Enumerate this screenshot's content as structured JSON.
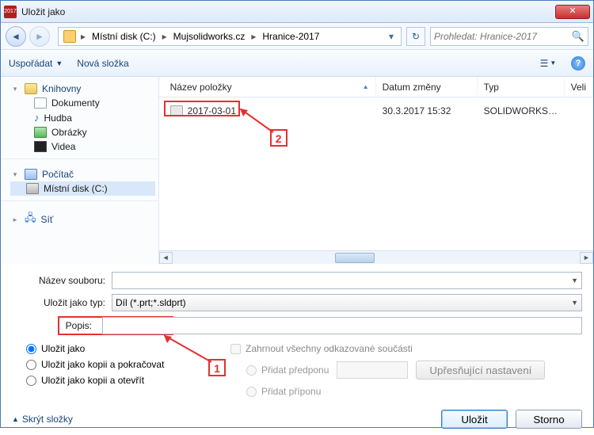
{
  "window": {
    "title": "Uložit jako",
    "app_badge": "2017"
  },
  "nav": {
    "breadcrumb": [
      "Místní disk (C:)",
      "Mujsolidworks.cz",
      "Hranice-2017"
    ],
    "search_placeholder": "Prohledat: Hranice-2017"
  },
  "toolbar": {
    "organize": "Uspořádat",
    "new_folder": "Nová složka"
  },
  "tree": {
    "libraries": "Knihovny",
    "documents": "Dokumenty",
    "music": "Hudba",
    "pictures": "Obrázky",
    "videos": "Videa",
    "computer": "Počítač",
    "local_disk": "Místní disk (C:)",
    "network": "Síť"
  },
  "columns": {
    "name": "Název položky",
    "date": "Datum změny",
    "type": "Typ",
    "size": "Veli"
  },
  "files": [
    {
      "name": "2017-03-01",
      "date": "30.3.2017 15:32",
      "type": "SOLIDWORKS Part..."
    }
  ],
  "form": {
    "filename_label": "Název souboru:",
    "filename_value": "",
    "filetype_label": "Uložit jako typ:",
    "filetype_value": "Díl (*.prt;*.sldprt)",
    "description_label": "Popis:"
  },
  "options": {
    "save_as": "Uložit jako",
    "save_copy_continue": "Uložit jako kopii a pokračovat",
    "save_copy_open": "Uložit jako kopii a otevřít",
    "include_refs": "Zahrnout všechny odkazované součásti",
    "add_prefix": "Přidat předponu",
    "add_suffix": "Přidat příponu",
    "advanced": "Upřesňující nastavení"
  },
  "footer": {
    "hide_folders": "Skrýt složky",
    "save": "Uložit",
    "cancel": "Storno"
  },
  "annotations": {
    "a1": "1",
    "a2": "2"
  }
}
